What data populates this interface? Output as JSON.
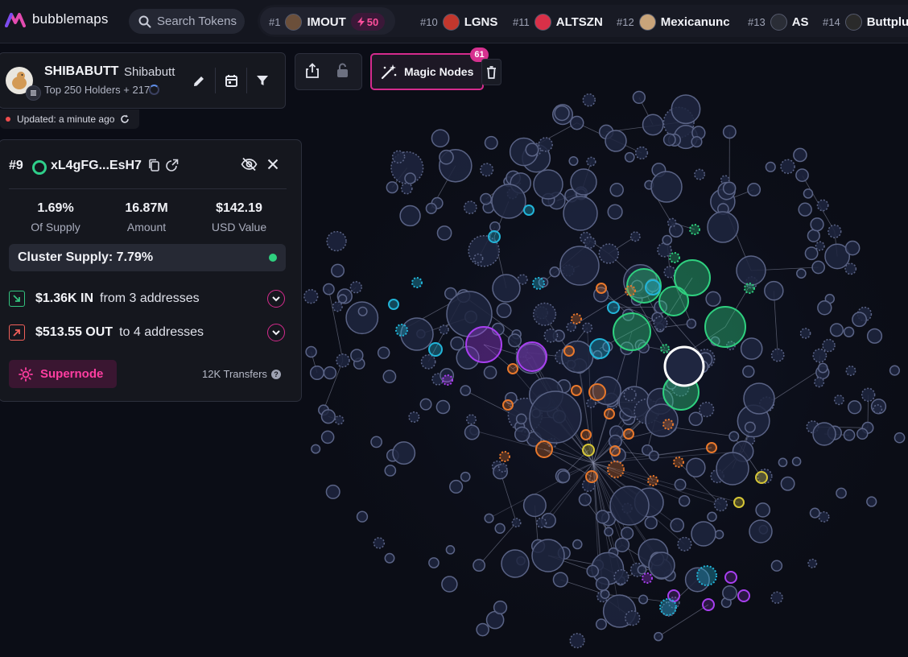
{
  "app": {
    "logo_text": "bubblemaps"
  },
  "search": {
    "placeholder": "Search Tokens"
  },
  "trending": [
    {
      "rank": "#1",
      "name": "IMOUT",
      "boost": "50",
      "avatar_color": "#6b4f3a"
    },
    {
      "rank": "#10",
      "name": "LGNS",
      "avatar_color": "#c2372d"
    },
    {
      "rank": "#11",
      "name": "ALTSZN",
      "avatar_color": "#d93048"
    },
    {
      "rank": "#12",
      "name": "Mexicanunc",
      "avatar_color": "#c9a47a"
    },
    {
      "rank": "#13",
      "name": "AS",
      "avatar_color": "#2a2d36"
    },
    {
      "rank": "#14",
      "name": "Buttplu",
      "avatar_color": "#2a2a2a"
    }
  ],
  "token": {
    "symbol": "SHIBABUTT",
    "name": "Shibabutt",
    "holders": "Top 250 Holders + 217",
    "updated": "Updated: a minute ago"
  },
  "toolbar": {
    "magic_label": "Magic Nodes",
    "magic_count": "61"
  },
  "detail": {
    "rank": "#9",
    "address": "xL4gFG...EsH7",
    "stats": [
      {
        "value": "1.69%",
        "label": "Of Supply"
      },
      {
        "value": "16.87M",
        "label": "Amount"
      },
      {
        "value": "$142.19",
        "label": "USD Value"
      }
    ],
    "cluster_supply": "Cluster Supply: 7.79%",
    "inflow": {
      "amount": "$1.36K IN",
      "desc": "from 3 addresses"
    },
    "outflow": {
      "amount": "$513.55 OUT",
      "desc": "to 4 addresses"
    },
    "supernode_label": "Supernode",
    "transfers": "12K Transfers"
  },
  "colors": {
    "accent": "#d52b8d",
    "bubble_default": "#1f2640",
    "bubble_stroke": "#5a6385",
    "green": "#2fd07f",
    "orange": "#e8782c",
    "cyan": "#22b4d8",
    "purple": "#a83ff0",
    "yellow": "#d6c636"
  }
}
